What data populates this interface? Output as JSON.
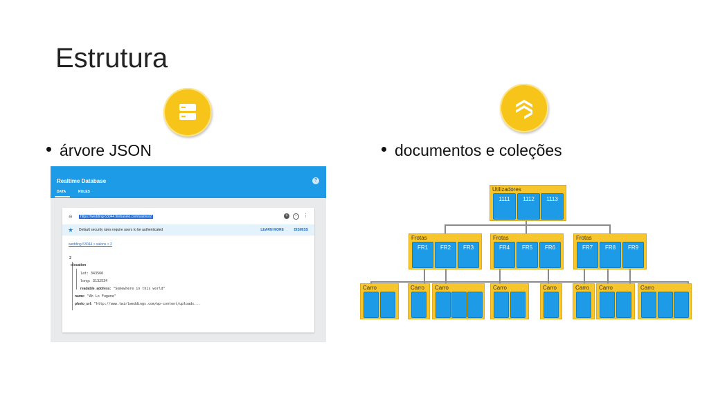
{
  "slide": {
    "title": "Estrutura",
    "left_bullet": "árvore JSON",
    "right_bullet": "documentos e coleções",
    "left_icon": "realtime-database-icon",
    "right_icon": "firestore-icon",
    "badge_color": "#f7c41a"
  },
  "console": {
    "title": "Realtime Database",
    "help": "?",
    "tabs": [
      "DATA",
      "RULES"
    ],
    "url": "https://wedding-53044.firebaseio.com/salons/2",
    "warning": "Default security rules require users to be authenticated",
    "learn_more": "LEARN MORE",
    "dismiss": "DISMISS",
    "breadcrumb": "wedding-53044 > salons > 2",
    "tree": {
      "root": "2",
      "location": "location",
      "lat": "lat: 343566",
      "long": "long: 3132534",
      "readable_address_key": "readable_address:",
      "readable_address_val": "\"Somewhere in this world\"",
      "name_key": "name:",
      "name_val": "\"Ah Lo Fugene\"",
      "photo_url_key": "photo_url:",
      "photo_url_val": "\"http://www.twirlweddings.com/wp-content/uploads..."
    },
    "header_color": "#1e9be6"
  },
  "diagram": {
    "root": {
      "label": "Utilizadores",
      "docs": [
        "1111",
        "1112",
        "1113"
      ]
    },
    "fleets": [
      {
        "label": "Frotas",
        "docs": [
          "FR1",
          "FR2",
          "FR3"
        ]
      },
      {
        "label": "Frotas",
        "docs": [
          "FR4",
          "FR5",
          "FR6"
        ]
      },
      {
        "label": "Frotas",
        "docs": [
          "FR7",
          "FR8",
          "FR9"
        ]
      }
    ],
    "cars": [
      {
        "label": "Carro",
        "count": 2
      },
      {
        "label": "Carro",
        "count": 1
      },
      {
        "label": "Carro",
        "count": 3
      },
      {
        "label": "Carro",
        "count": 2
      },
      {
        "label": "Carro",
        "count": 1
      },
      {
        "label": "Carro",
        "count": 1
      },
      {
        "label": "Carro",
        "count": 2
      },
      {
        "label": "Carro",
        "count": 3
      }
    ],
    "collection_color": "#f7c62d",
    "document_color": "#1e9be6"
  }
}
